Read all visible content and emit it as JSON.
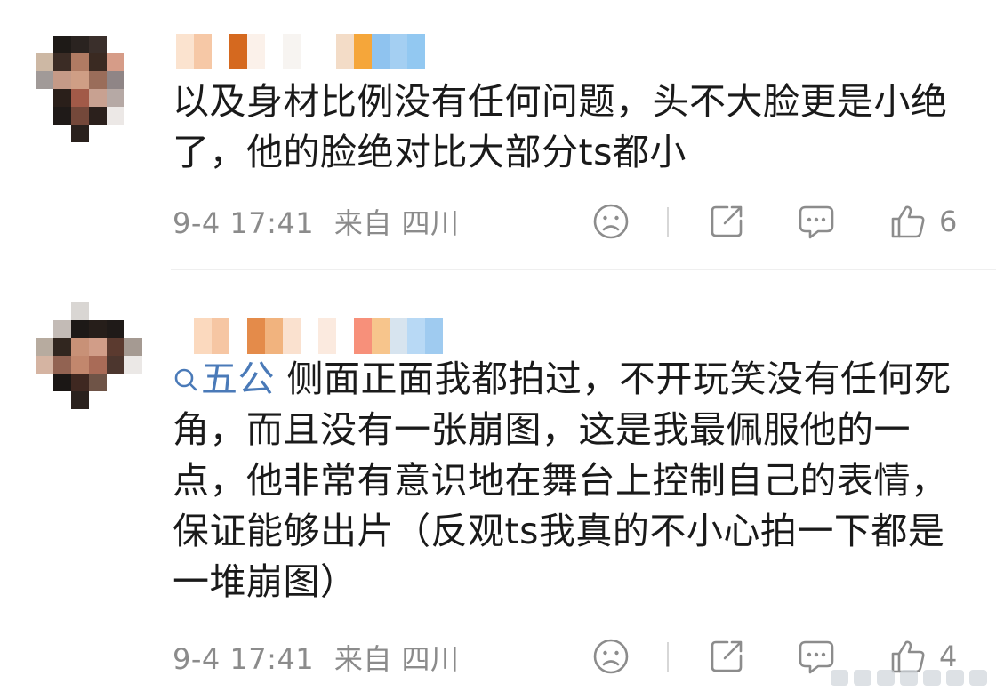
{
  "comments": [
    {
      "text": "以及身材比例没有任何问题，头不大脸更是小绝了，他的脸绝对比大部分ts都小",
      "time": "9-4 17:41",
      "location": "来自 四川",
      "like_count": "6"
    },
    {
      "link_text": "五公",
      "text": " 侧面正面我都拍过，不开玩笑没有任何死角，而且没有一张崩图，这是我最佩服他的一点，他非常有意识地在舞台上控制自己的表情，保证能够出片（反观ts我真的不小心拍一下都是一堆崩图）",
      "time": "9-4 17:41",
      "location": "来自 四川",
      "like_count": "4"
    }
  ],
  "icons": {
    "dislike": "sad-face-icon",
    "share": "share-icon",
    "reply": "comment-bubble-icon",
    "like": "thumbs-up-icon",
    "search": "search-icon"
  },
  "colors": {
    "link": "#4a7ab8",
    "meta": "#8b8b8b",
    "icon": "#8c8c8c"
  }
}
